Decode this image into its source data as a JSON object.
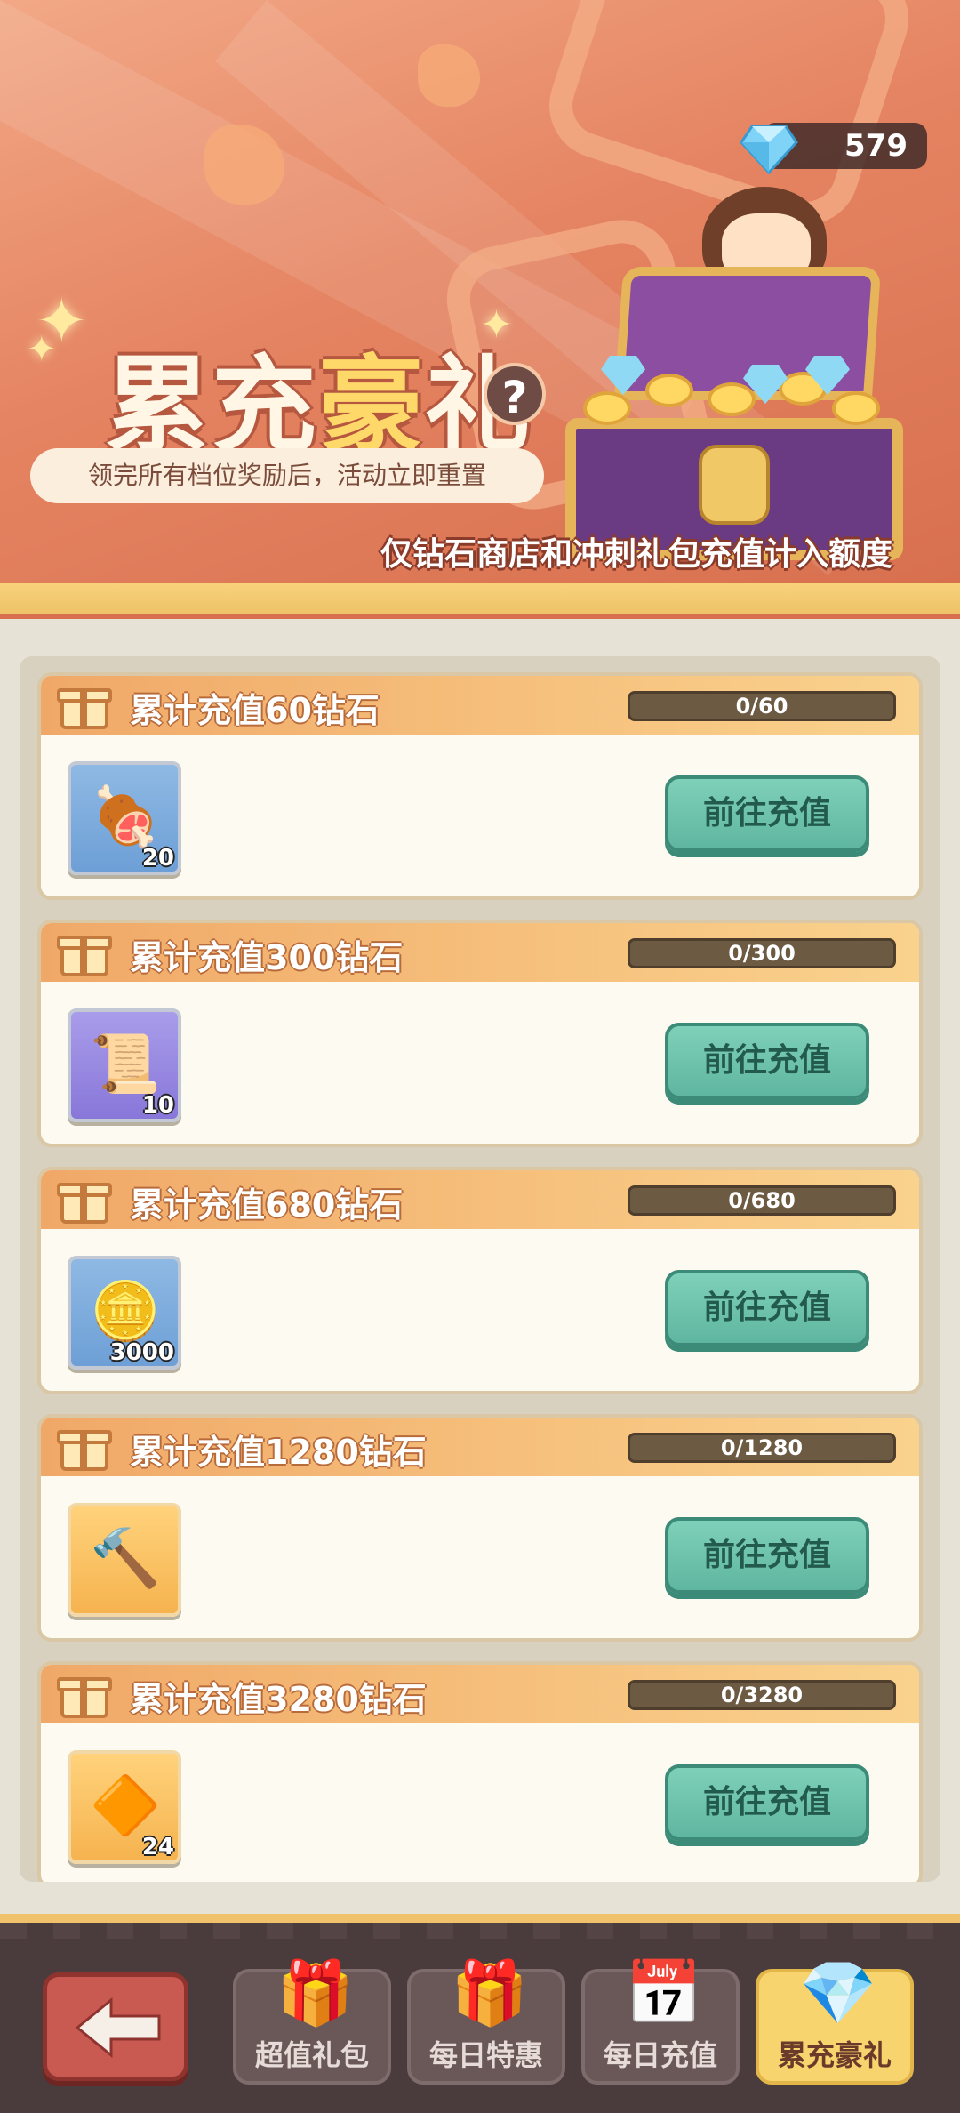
{
  "header": {
    "diamond_count": "579",
    "title_prefix": "累充",
    "title_highlight": "豪",
    "title_suffix": "礼",
    "help_label": "?",
    "subtitle": "领完所有档位奖励后，活动立即重置",
    "note": "仅钻石商店和冲刺礼包充值计入额度"
  },
  "tiers": [
    {
      "title": "累计充值60钻石",
      "progress": "0/60",
      "progress_fraction": 0,
      "item": "meat",
      "item_glyph": "🍖",
      "count": "20",
      "bg": "blue",
      "button": "前往充值"
    },
    {
      "title": "累计充值300钻石",
      "progress": "0/300",
      "progress_fraction": 0,
      "item": "integral-ticket",
      "item_glyph": "📜",
      "count": "10",
      "bg": "purple",
      "button": "前往充值"
    },
    {
      "title": "累计充值680钻石",
      "progress": "0/680",
      "progress_fraction": 0,
      "item": "gold-coin",
      "item_glyph": "🪙",
      "count": "3000",
      "bg": "blue",
      "button": "前往充值"
    },
    {
      "title": "累计充值1280钻石",
      "progress": "0/1280",
      "progress_fraction": 0,
      "item": "magic-hammer",
      "item_glyph": "🔨",
      "count": "",
      "bg": "orange",
      "button": "前往充值"
    },
    {
      "title": "累计充值3280钻石",
      "progress": "0/3280",
      "progress_fraction": 0,
      "item": "orange-crystal",
      "item_glyph": "🔶",
      "count": "24",
      "bg": "orange",
      "button": "前往充值"
    }
  ],
  "nav": {
    "back_icon": "arrow-left-icon",
    "tabs": [
      {
        "label": "超值礼包",
        "icon": "gift-box-icon",
        "glyph": "🎁",
        "active": false
      },
      {
        "label": "每日特惠",
        "icon": "gift-clock-icon",
        "glyph": "🎁",
        "active": false
      },
      {
        "label": "每日充值",
        "icon": "calendar-coins-icon",
        "glyph": "📅",
        "active": false
      },
      {
        "label": "累充豪礼",
        "icon": "gem-bag-icon",
        "glyph": "💎",
        "active": true
      }
    ]
  },
  "colors": {
    "accent_gold": "#f7d46d",
    "button_teal": "#5fb6a0",
    "banner_orange": "#e58462"
  }
}
